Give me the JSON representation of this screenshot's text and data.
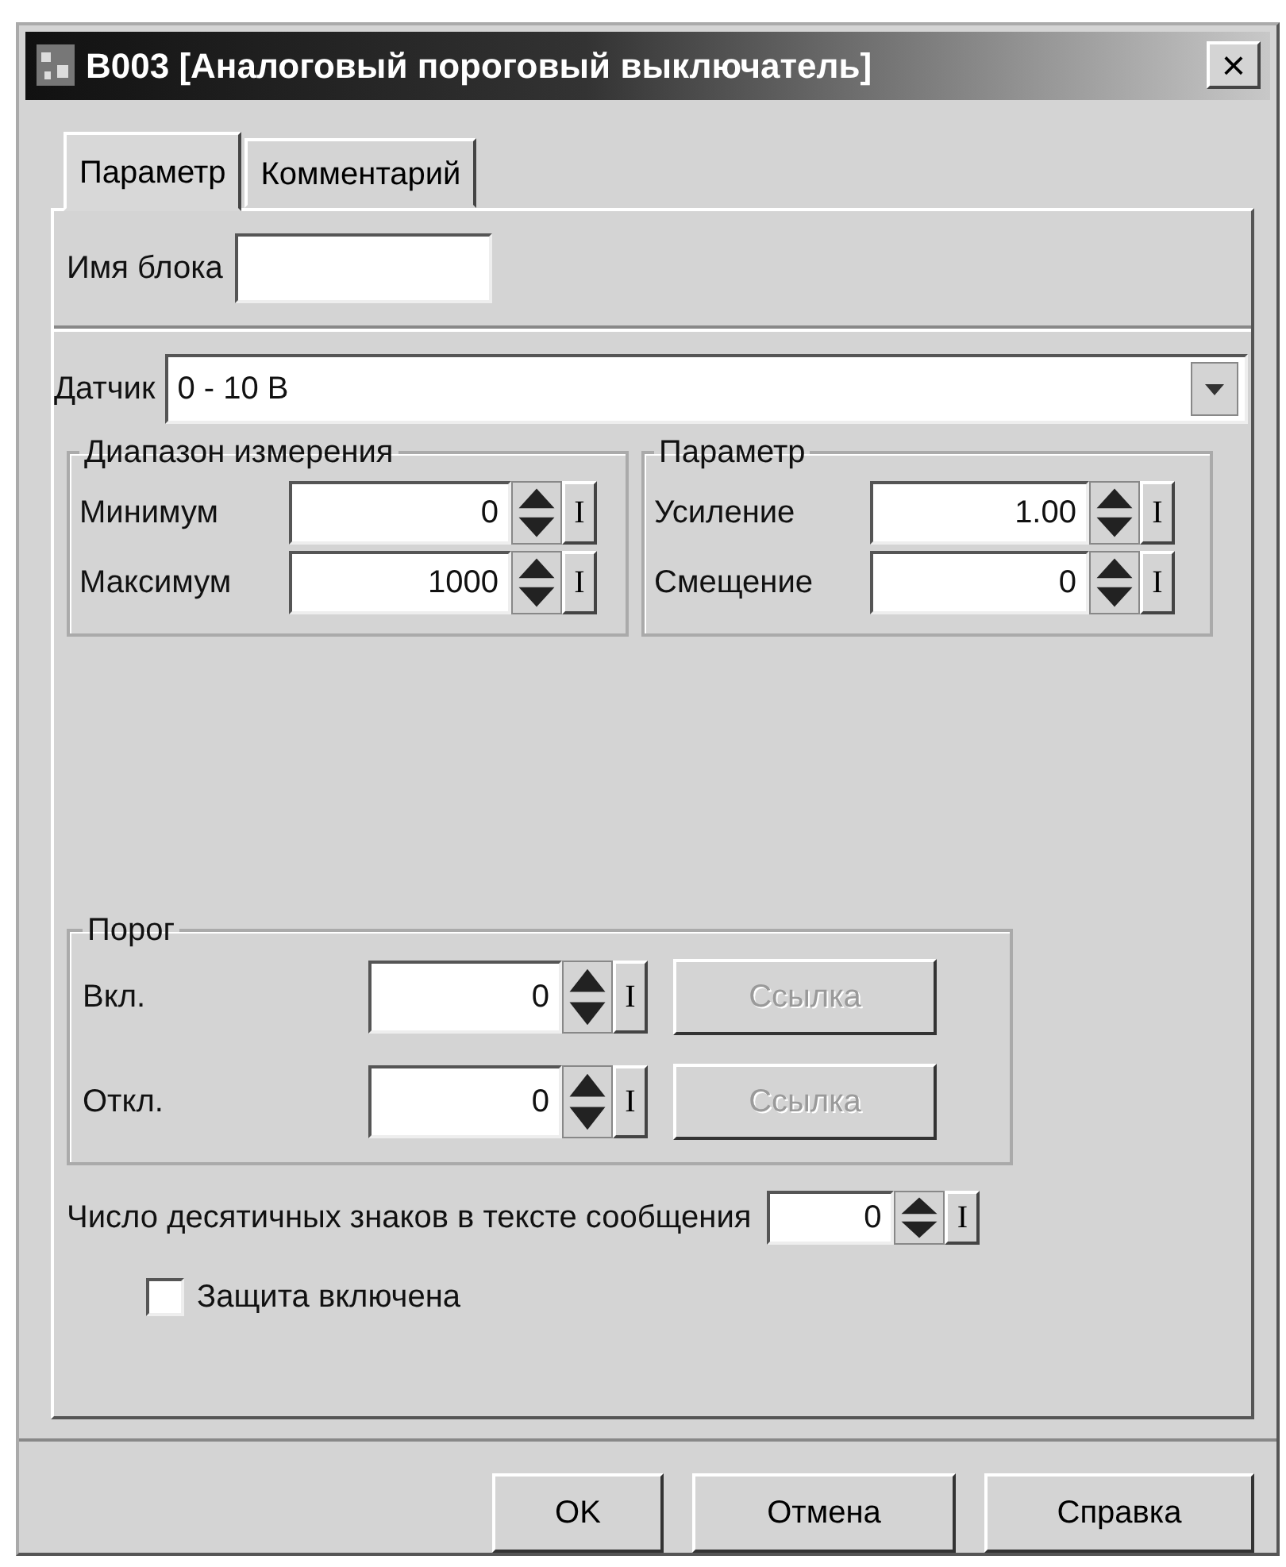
{
  "window": {
    "title": "B003 [Аналоговый пороговый выключатель]",
    "close": "×"
  },
  "tabs": [
    {
      "label": "Параметр",
      "selected": true
    },
    {
      "label": "Комментарий",
      "selected": false
    }
  ],
  "block_name": {
    "label": "Имя блока"
  },
  "sensor": {
    "label": "Датчик",
    "value": "0 - 10 В"
  },
  "groups": [
    {
      "title": "Диапазон измерения",
      "fields": [
        {
          "label": "Минимум",
          "value": "0",
          "link": "I"
        },
        {
          "label": "Максимум",
          "value": "1000",
          "link": "I"
        }
      ]
    },
    {
      "title": "Параметр",
      "fields": [
        {
          "label": "Усиление",
          "value": "1.00",
          "link": "I"
        },
        {
          "label": "Смещение",
          "value": "0",
          "link": "I"
        }
      ]
    }
  ],
  "threshold": {
    "title": "Порог",
    "fields": [
      {
        "label": "Вкл.",
        "value": "0",
        "link": "I",
        "button": {
          "label": "Ссылка",
          "disabled": true
        }
      },
      {
        "label": "Откл.",
        "value": "0",
        "link": "I",
        "button": {
          "label": "Ссылка",
          "disabled": true
        }
      }
    ]
  },
  "decimals": {
    "label": "Число десятичных знаков в тексте сообщения",
    "value": "0",
    "link": "I"
  },
  "protection": {
    "label": "Защита включена",
    "checked": false
  },
  "buttons": [
    {
      "label": "OK"
    },
    {
      "label": "Отмена"
    },
    {
      "label": "Справка"
    }
  ]
}
